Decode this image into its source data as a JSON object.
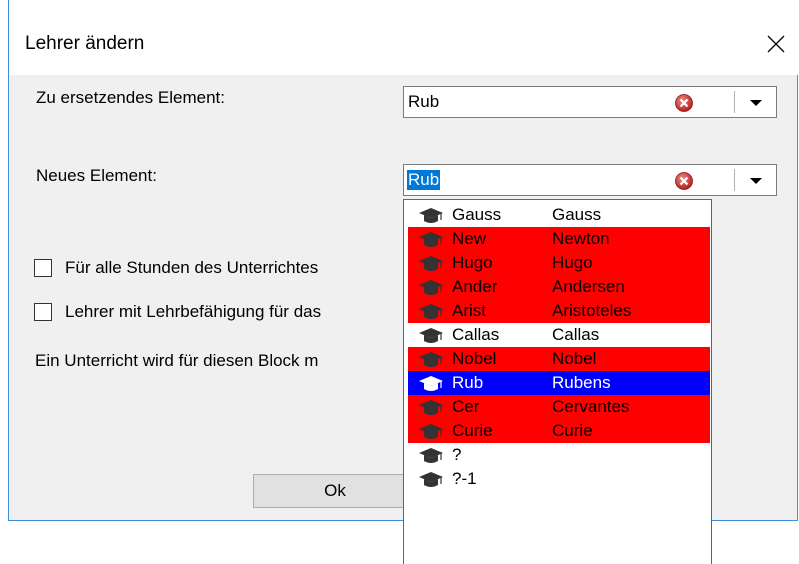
{
  "dialog": {
    "title": "Lehrer ändern",
    "close_symbol": "×"
  },
  "replace_field": {
    "label": "Zu ersetzendes Element:",
    "value": "Rub"
  },
  "new_field": {
    "label": "Neues Element:",
    "value": "Rub"
  },
  "checkboxes": [
    {
      "label": "Für alle Stunden des Unterrichtes",
      "checked": false
    },
    {
      "label": "Lehrer mit Lehrbefähigung für das",
      "checked": false
    }
  ],
  "info_text": "Ein Unterricht wird für diesen Block m",
  "ok_label": "Ok",
  "colors": {
    "highlight_red": "#ff0000",
    "selected_blue": "#0000ff",
    "selection_accent": "#0078d7",
    "border_accent": "#3c8fd8"
  },
  "dropdown": {
    "icon": "graduation-cap-icon",
    "items": [
      {
        "short": "Gauss",
        "long": "Gauss",
        "state": "normal"
      },
      {
        "short": "New",
        "long": "Newton",
        "state": "red"
      },
      {
        "short": "Hugo",
        "long": "Hugo",
        "state": "red"
      },
      {
        "short": "Ander",
        "long": "Andersen",
        "state": "red"
      },
      {
        "short": "Arist",
        "long": "Aristoteles",
        "state": "red"
      },
      {
        "short": "Callas",
        "long": "Callas",
        "state": "normal"
      },
      {
        "short": "Nobel",
        "long": "Nobel",
        "state": "red"
      },
      {
        "short": "Rub",
        "long": "Rubens",
        "state": "selected"
      },
      {
        "short": "Cer",
        "long": "Cervantes",
        "state": "red"
      },
      {
        "short": "Curie",
        "long": "Curie",
        "state": "red"
      },
      {
        "short": "?",
        "long": "",
        "state": "normal"
      },
      {
        "short": "?-1",
        "long": "",
        "state": "normal"
      }
    ]
  }
}
